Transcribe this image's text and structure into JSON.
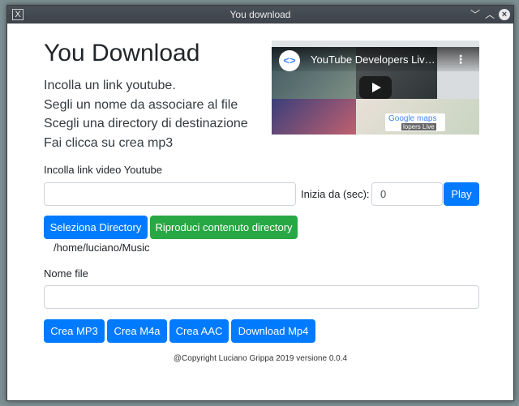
{
  "window": {
    "title": "You download",
    "app_icon": "X"
  },
  "heading": "You Download",
  "instructions": [
    "Incolla un link youtube.",
    "Segli un nome da associare al file",
    "Scegli una directory di destinazione",
    "Fai clicca su crea mp3"
  ],
  "video": {
    "title": "YouTube Developers Liv…",
    "maps_label": "Google maps",
    "live_label": "lopers Live"
  },
  "link": {
    "label": "Incolla link video Youtube",
    "value": "",
    "start_label": "Inizia da (sec):",
    "start_value": "0",
    "play_label": "Play"
  },
  "directory": {
    "select_label": "Seleziona Directory",
    "play_dir_label": "Riproduci contenuto directory",
    "path": "/home/luciano/Music"
  },
  "filename": {
    "label": "Nome file",
    "value": ""
  },
  "actions": {
    "mp3": "Crea MP3",
    "m4a": "Crea M4a",
    "aac": "Crea AAC",
    "mp4": "Download Mp4"
  },
  "footer": "@Copyright Luciano Grippa 2019 versione 0.0.4",
  "colors": {
    "primary": "#007bff",
    "success": "#28a745",
    "titlebar": "#3d434a"
  }
}
